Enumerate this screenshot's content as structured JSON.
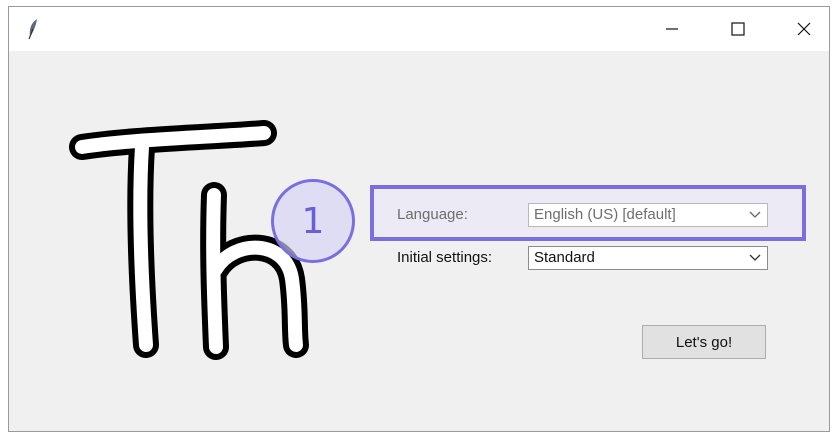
{
  "titlebar": {
    "app_icon": "feather-icon",
    "minimize_icon": "minimize-icon",
    "maximize_icon": "maximize-icon",
    "close_icon": "close-icon"
  },
  "logo": {
    "text": "Th"
  },
  "annotation": {
    "number": "1",
    "color": "#7b6fe0"
  },
  "form": {
    "language_label": "Language:",
    "language_value": "English (US) [default]",
    "settings_label": "Initial settings:",
    "settings_value": "Standard",
    "go_button": "Let's go!"
  }
}
